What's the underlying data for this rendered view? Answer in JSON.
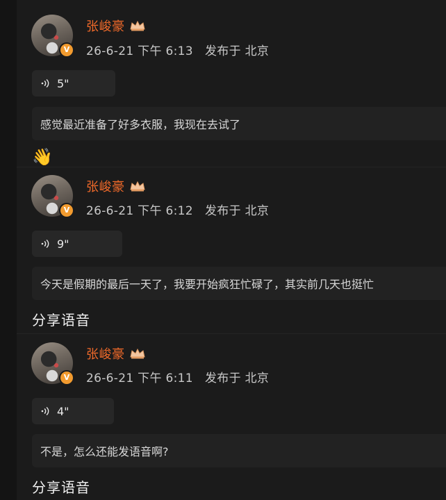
{
  "posts": [
    {
      "username": "张峻豪",
      "time": "26-6-21 下午 6:13",
      "location": "发布于 北京",
      "voice_duration": "5\"",
      "text": "感觉最近准备了好多衣服，我现在去试了"
    },
    {
      "username": "张峻豪",
      "time": "26-6-21 下午 6:12",
      "location": "发布于 北京",
      "voice_duration": "9\"",
      "text": "今天是假期的最后一天了，我要开始疯狂忙碌了，其实前几天也挺忙"
    },
    {
      "username": "张峻豪",
      "time": "26-6-21 下午 6:11",
      "location": "发布于 北京",
      "voice_duration": "4\"",
      "text": "不是，怎么还能发语音啊?"
    }
  ],
  "captions": {
    "wave_emoji": "👋",
    "share_voice_1": "分享语音",
    "share_voice_2": "分享语音"
  },
  "badges": {
    "verified_letter": "V"
  },
  "colors": {
    "accent_name": "#f06a2a",
    "verified_badge": "#f29b2f",
    "background": "#1b1b1b",
    "card": "#222222"
  },
  "icons": {
    "verified": "verified-icon",
    "vip": "crown-icon",
    "voice": "sound-wave-icon"
  }
}
